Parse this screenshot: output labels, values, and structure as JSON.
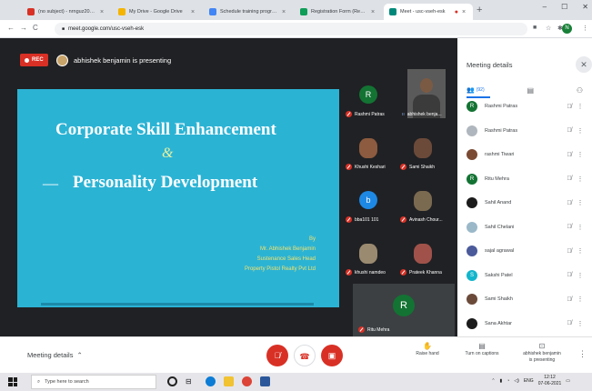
{
  "browser": {
    "tabs": [
      {
        "title": "(no subject) - nrnguz2021@gm",
        "fav": "#d93025"
      },
      {
        "title": "My Drive - Google Drive",
        "fav": "#f4b400"
      },
      {
        "title": "Schedule training program.doc",
        "fav": "#4285f4"
      },
      {
        "title": "Registration Form (Responses)",
        "fav": "#0f9d58"
      },
      {
        "title": "Meet - usc-vseh-esk",
        "fav": "#00897b"
      }
    ],
    "url": "meet.google.com/usc-vseh-esk",
    "profile_initial": "N"
  },
  "meet": {
    "rec_label": "REC",
    "presenting_text": "abhishek benjamin is presenting",
    "slide": {
      "title_line1": "Corporate Skill Enhancement",
      "amp": "&",
      "dash": "—",
      "title_line2": "Personality Development",
      "by": "By",
      "presenter_name": "Mr. Abhishek Benjamin",
      "presenter_role": "Sustenance Sales Head",
      "presenter_company": "Property Pistol Realty Pvt Ltd"
    },
    "tiles": [
      {
        "name": "Rashmi Patras",
        "initial": "R",
        "color": "#137333"
      },
      {
        "name": "abhishek benja..."
      },
      {
        "name": "Khushi Keshari",
        "color": "#8d5b3f"
      },
      {
        "name": "Sami Shaikh",
        "color": "#6b4a3a"
      },
      {
        "name": "bba101 101",
        "initial": "b",
        "color": "#1e88e5"
      },
      {
        "name": "Avinash Chour...",
        "color": "#7a6a50"
      },
      {
        "name": "khushi namdeo",
        "color": "#9a8a70"
      },
      {
        "name": "Prateek Khanna",
        "color": "#a0524a"
      }
    ],
    "big_tile": {
      "name": "Ritu Mehra",
      "initial": "R"
    }
  },
  "panel": {
    "title": "Meeting details",
    "people_count": "(92)",
    "participants": [
      {
        "name": "Rashmi Patras",
        "initial": "R",
        "color": "#137333"
      },
      {
        "name": "Rashmi Patras",
        "initial": "",
        "color": "#b0b6bd"
      },
      {
        "name": "rashmi Tiwari",
        "initial": "",
        "color": "#7b4a33"
      },
      {
        "name": "Ritu Mehra",
        "initial": "R",
        "color": "#137333"
      },
      {
        "name": "Sahil Anand",
        "initial": "",
        "color": "#1b1b1b"
      },
      {
        "name": "Sahil Chelani",
        "initial": "",
        "color": "#9bb8c9"
      },
      {
        "name": "sajal agrawal",
        "initial": "",
        "color": "#4a5a9a"
      },
      {
        "name": "Sakshi Patel",
        "initial": "S",
        "color": "#12b5cb"
      },
      {
        "name": "Sami Shaikh",
        "initial": "",
        "color": "#6b4a3a"
      },
      {
        "name": "Sana Akhtar",
        "initial": "",
        "color": "#1b1b1b"
      }
    ]
  },
  "controls": {
    "meeting_details": "Meeting details",
    "raise_hand": "Raise hand",
    "captions": "Turn on captions",
    "presenting_line1": "abhishek benjamin",
    "presenting_line2": "is presenting"
  },
  "taskbar": {
    "search_placeholder": "Type here to search",
    "time": "12:12",
    "date": "07-06-2021",
    "lang": "ENG"
  }
}
